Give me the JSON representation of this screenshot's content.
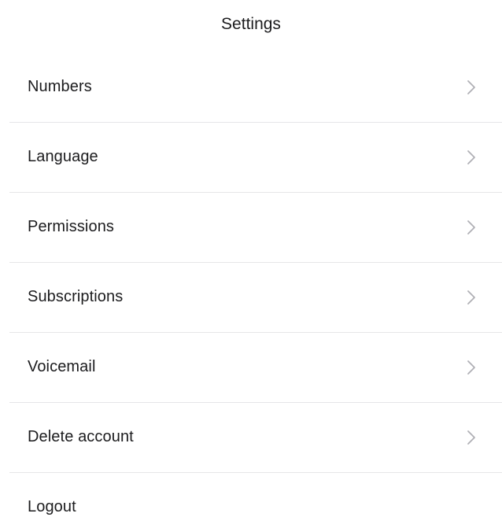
{
  "header": {
    "title": "Settings"
  },
  "settings": {
    "items": [
      {
        "label": "Numbers",
        "has_chevron": true
      },
      {
        "label": "Language",
        "has_chevron": true
      },
      {
        "label": "Permissions",
        "has_chevron": true
      },
      {
        "label": "Subscriptions",
        "has_chevron": true
      },
      {
        "label": "Voicemail",
        "has_chevron": true
      },
      {
        "label": "Delete account",
        "has_chevron": true
      },
      {
        "label": "Logout",
        "has_chevron": false
      }
    ]
  },
  "icons": {
    "chevron": "chevron-right-icon"
  },
  "colors": {
    "text": "#1c1c1e",
    "separator": "#e6e6e8",
    "chevron": "#b0b0b5",
    "background": "#ffffff"
  }
}
